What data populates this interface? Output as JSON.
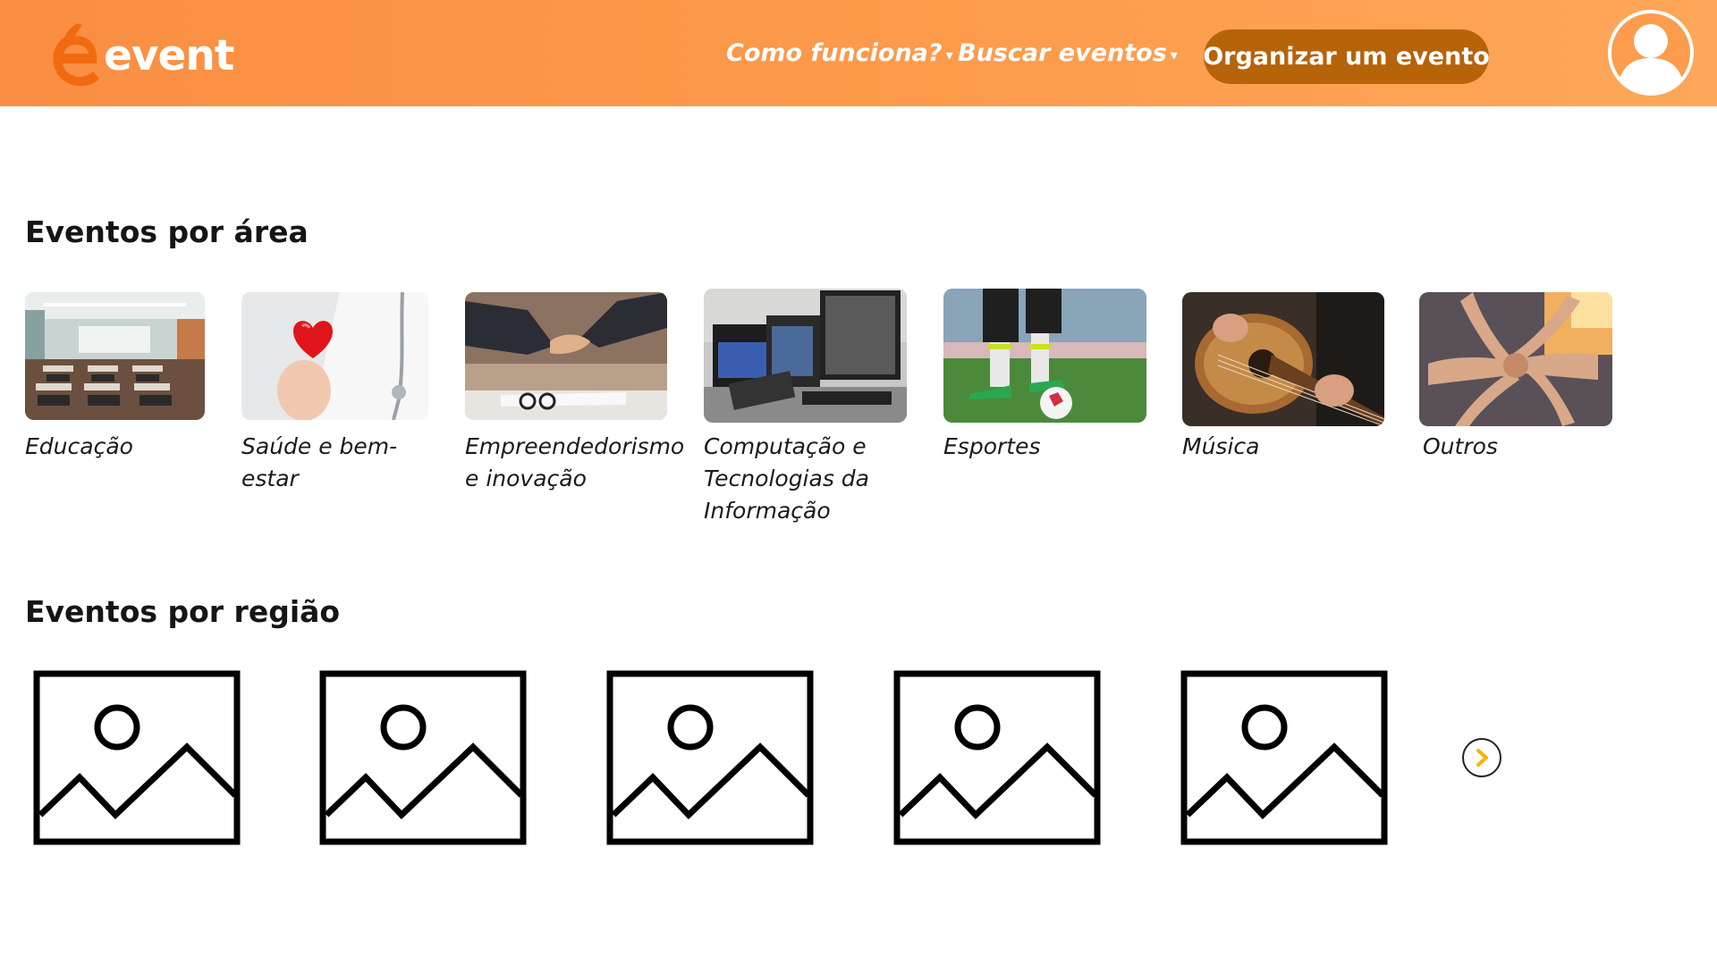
{
  "header": {
    "logo_text": "event",
    "nav": [
      {
        "label": "Como funciona?",
        "caret": "▾"
      },
      {
        "label": "Buscar eventos",
        "caret": "▾"
      }
    ],
    "cta_label": "Organizar um evento"
  },
  "area_section": {
    "title": "Eventos por área",
    "categories": [
      {
        "label": "Educação"
      },
      {
        "label": "Saúde e bem-estar"
      },
      {
        "label": "Empreendedorismo\ne inovação"
      },
      {
        "label": "Computação e\nTecnologias da\nInformação"
      },
      {
        "label": "Esportes"
      },
      {
        "label": "Música"
      },
      {
        "label": "Outros"
      }
    ]
  },
  "region_section": {
    "title": "Eventos por região",
    "cards": [
      {
        "icon": "image-placeholder-icon"
      },
      {
        "icon": "image-placeholder-icon"
      },
      {
        "icon": "image-placeholder-icon"
      },
      {
        "icon": "image-placeholder-icon"
      },
      {
        "icon": "image-placeholder-icon"
      }
    ],
    "next_icon": "chevron-right-icon"
  },
  "colors": {
    "header_orange": "#fd9c4c",
    "cta_brown": "#b6630a",
    "logo_orange": "#f26a10",
    "arrow_yellow": "#f5b400"
  }
}
